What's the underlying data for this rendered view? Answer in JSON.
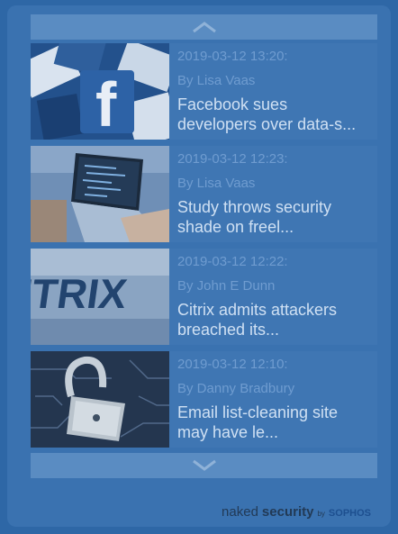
{
  "feed": {
    "items": [
      {
        "date": "2019-03-12 13:20:",
        "author": "By Lisa Vaas",
        "title": "Facebook sues developers over data-s..."
      },
      {
        "date": "2019-03-12 12:23:",
        "author": "By Lisa Vaas",
        "title": "Study throws security shade on freel..."
      },
      {
        "date": "2019-03-12 12:22:",
        "author": "By John E Dunn",
        "title": "Citrix admits attackers breached its..."
      },
      {
        "date": "2019-03-12 12:10:",
        "author": "By Danny Bradbury",
        "title": "Email list-cleaning site may have le..."
      }
    ]
  },
  "brand": {
    "naked": "naked",
    "security": "security",
    "by": "by",
    "sophos": "SOPHOS"
  },
  "thumbnails": {
    "item0_text": "f",
    "item2_text": "ITRIX"
  },
  "colors": {
    "background": "#2e67a6",
    "item_bg": "#3f76b3",
    "meta_text": "#6f9cd0",
    "title_text": "#cfe0f3"
  }
}
